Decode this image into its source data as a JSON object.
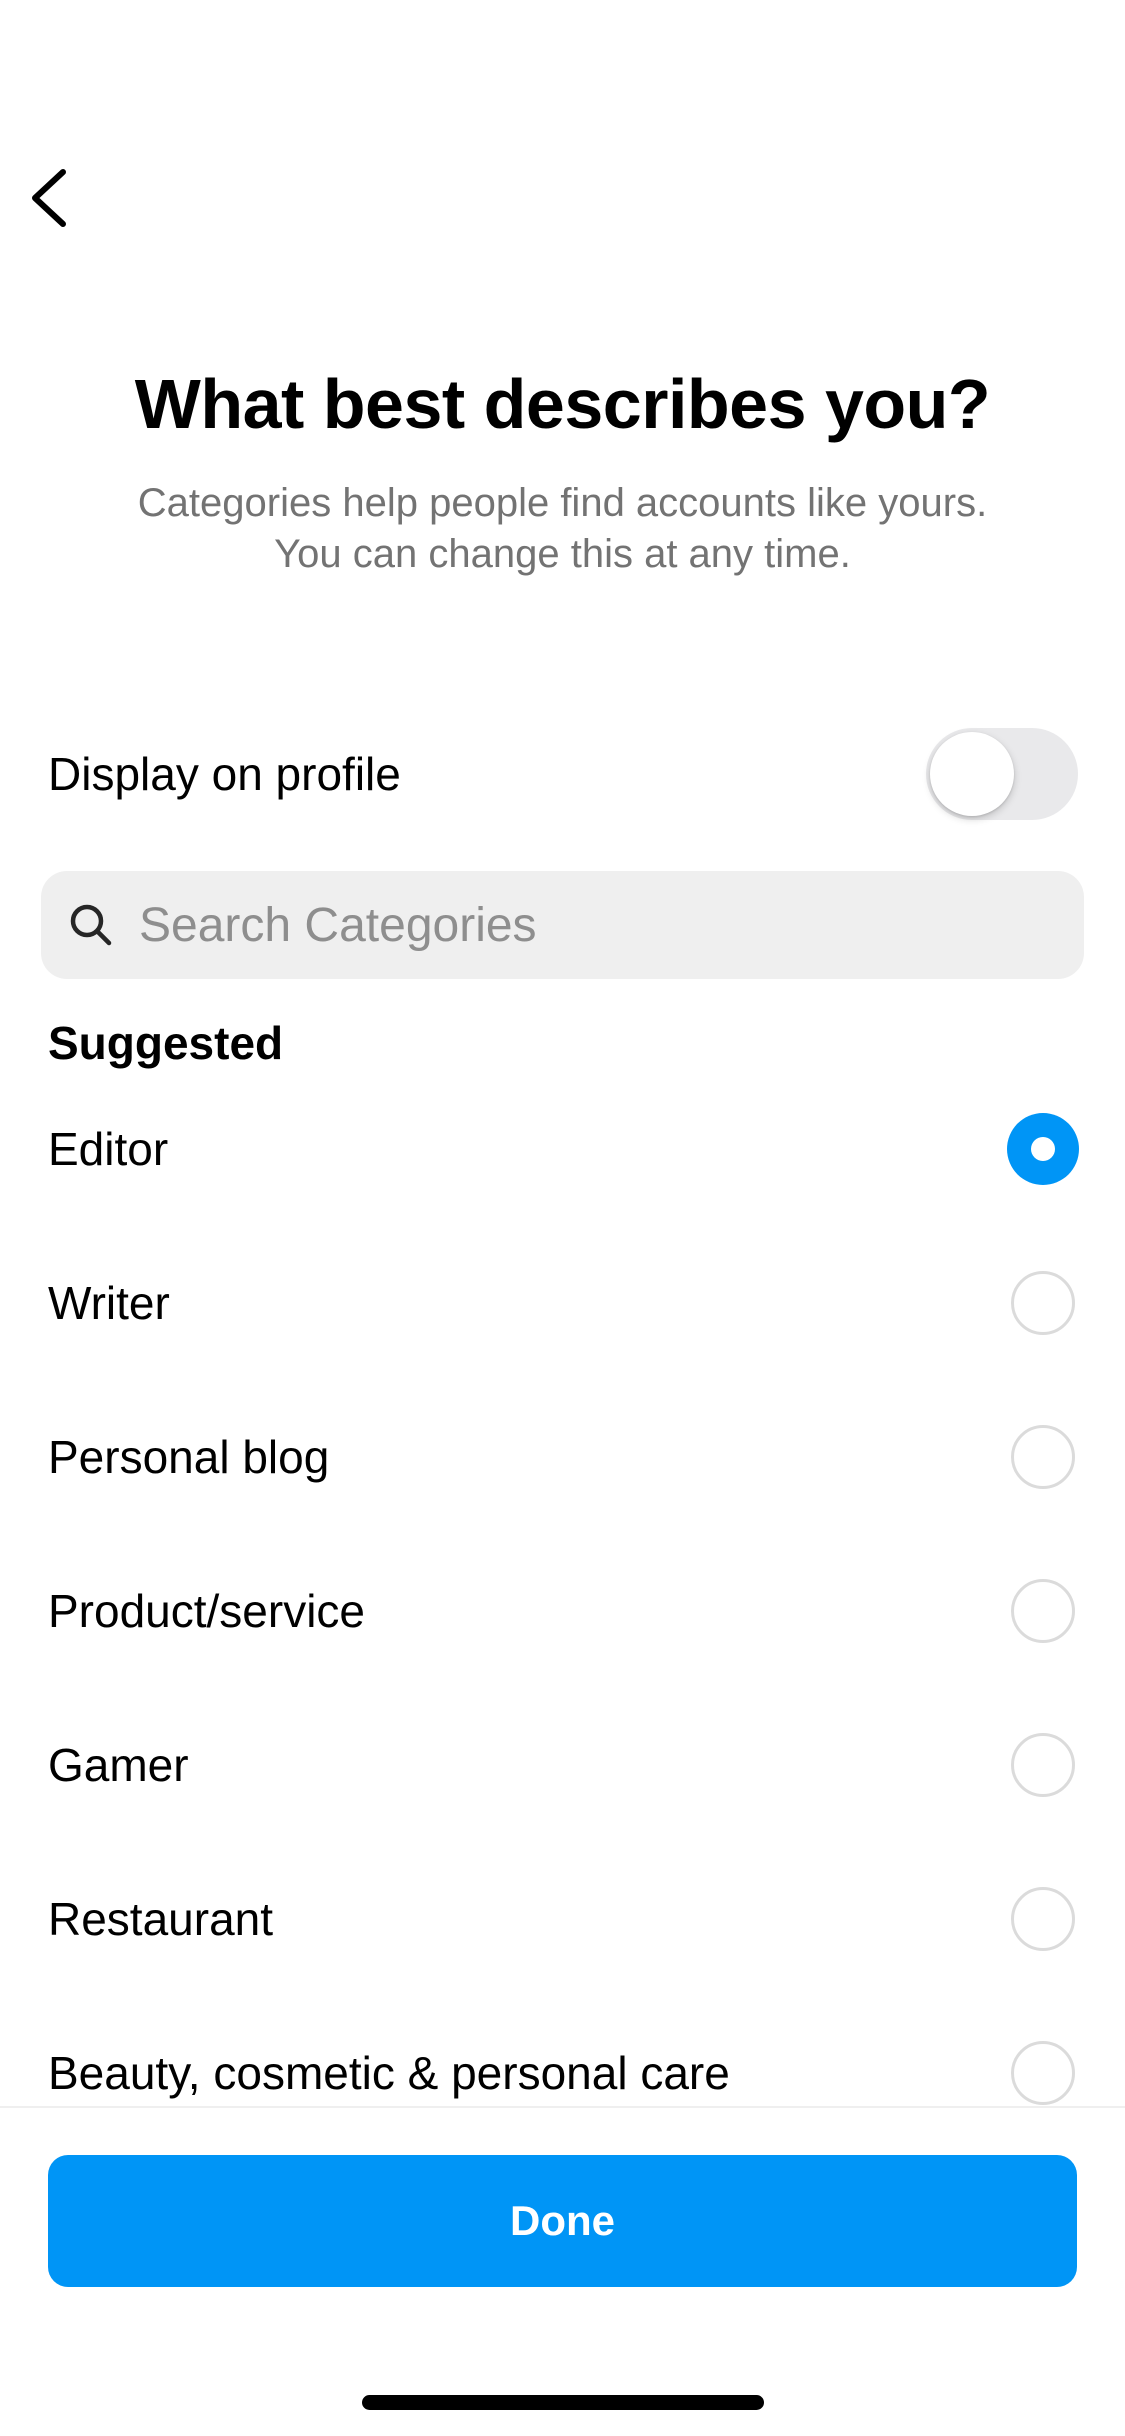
{
  "header": {
    "back_icon": "chevron-left-icon"
  },
  "intro": {
    "title": "What best describes you?",
    "subtitle_line1": "Categories help people find accounts like yours.",
    "subtitle_line2": "You can change this at any time."
  },
  "display_toggle": {
    "label": "Display on profile",
    "enabled": false
  },
  "search": {
    "placeholder": "Search Categories",
    "value": "",
    "icon": "search-icon"
  },
  "suggested": {
    "heading": "Suggested",
    "items": [
      {
        "label": "Editor",
        "selected": true
      },
      {
        "label": "Writer",
        "selected": false
      },
      {
        "label": "Personal blog",
        "selected": false
      },
      {
        "label": "Product/service",
        "selected": false
      },
      {
        "label": "Gamer",
        "selected": false
      },
      {
        "label": "Restaurant",
        "selected": false
      },
      {
        "label": "Beauty, cosmetic & personal care",
        "selected": false
      }
    ]
  },
  "footer": {
    "done_label": "Done"
  },
  "colors": {
    "accent": "#0095f6",
    "secondary_text": "#737373",
    "search_background": "#efefef",
    "radio_border": "#dbdbdb"
  }
}
